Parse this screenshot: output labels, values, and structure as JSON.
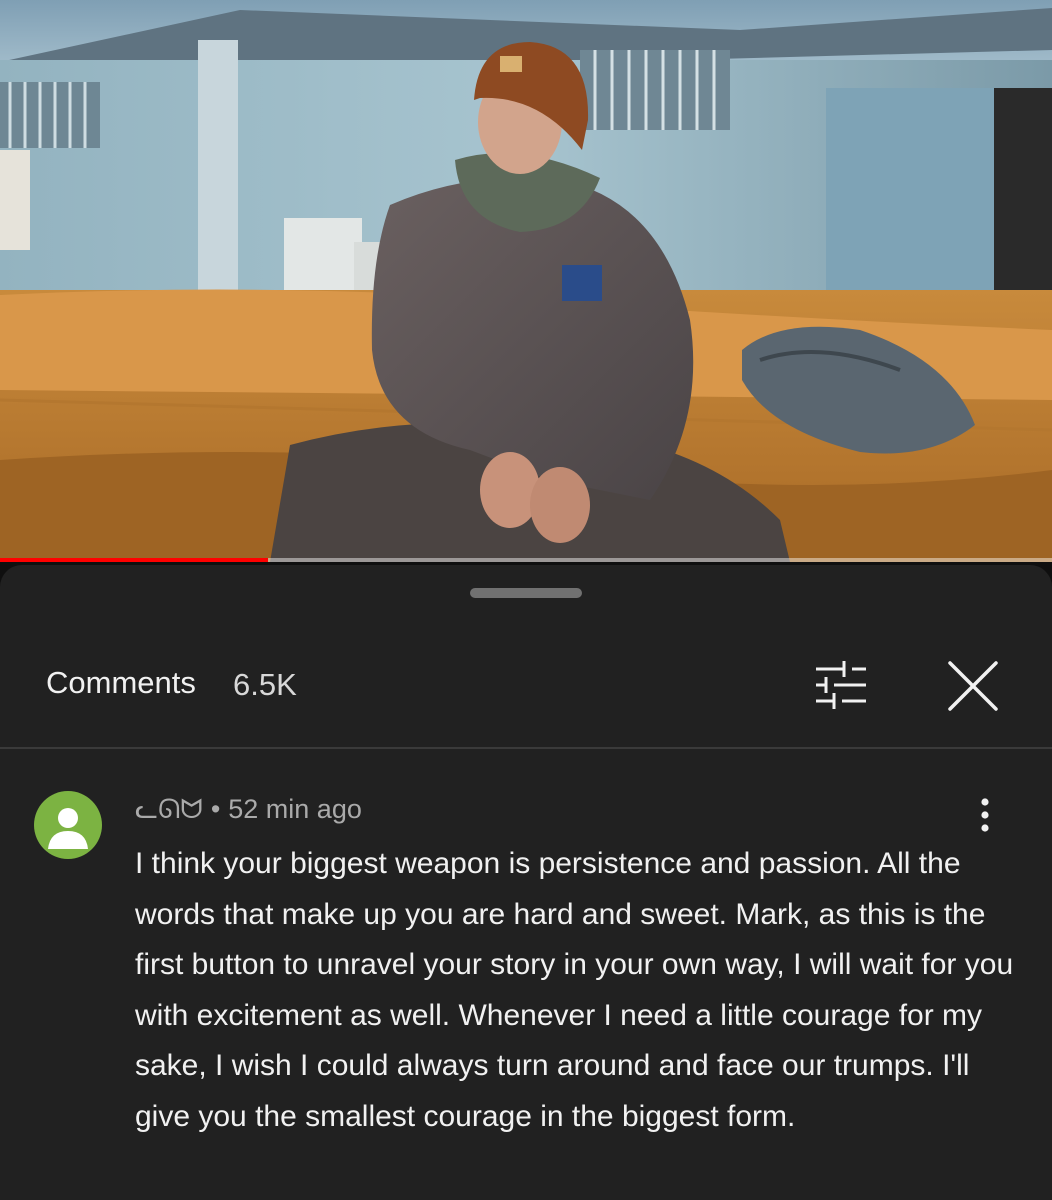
{
  "player": {
    "progress_fraction": 0.255,
    "colors": {
      "played": "#ff0000",
      "unplayed": "#bdbdbd"
    }
  },
  "comments_panel": {
    "title": "Comments",
    "count": "6.5K",
    "filter_icon": "sliders-icon",
    "close_icon": "close-icon"
  },
  "comment": {
    "author": "ᓚᘏᗢ",
    "separator": "•",
    "time": "52 min ago",
    "more_icon": "more-vert-icon",
    "avatar_color": "#7cb342",
    "text": "I think your biggest weapon is persistence and passion. All the words that make up you are hard and sweet. Mark, as this is the first button to unravel your story in your own way, I will wait for you with excitement as well. Whenever I need a little courage for my sake, I wish I could always turn around and face our trumps. I'll give you the smallest courage in the biggest form."
  }
}
